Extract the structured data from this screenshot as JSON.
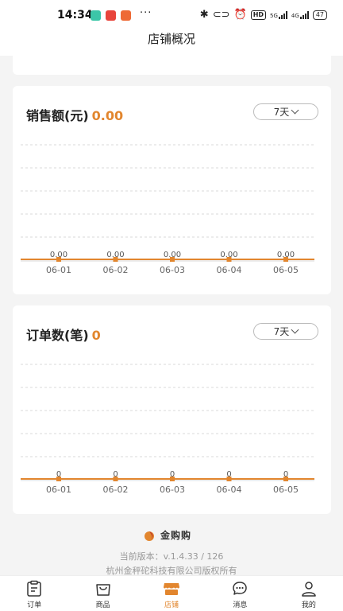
{
  "status_bar": {
    "time": "14:34",
    "dots": "···",
    "hd": "HD",
    "net1_label": "5G",
    "net2_label": "4G",
    "battery": "47"
  },
  "header": {
    "title": "店铺概况"
  },
  "sales_card": {
    "title": "销售额(元)",
    "total": "0.00",
    "period": "7天",
    "chart_data": {
      "type": "line",
      "categories": [
        "06-01",
        "06-02",
        "06-03",
        "06-04",
        "06-05"
      ],
      "series": [
        {
          "values": [
            0,
            0,
            0,
            0,
            0
          ],
          "labels": [
            "0.00",
            "0.00",
            "0.00",
            "0.00",
            "0.00"
          ]
        }
      ],
      "grid": true,
      "color": "#e2862e"
    }
  },
  "orders_card": {
    "title": "订单数(笔)",
    "total": "0",
    "period": "7天",
    "chart_data": {
      "type": "line",
      "categories": [
        "06-01",
        "06-02",
        "06-03",
        "06-04",
        "06-05"
      ],
      "series": [
        {
          "values": [
            0,
            0,
            0,
            0,
            0
          ],
          "labels": [
            "0",
            "0",
            "0",
            "0",
            "0"
          ]
        }
      ],
      "grid": true,
      "color": "#e2862e"
    }
  },
  "footer": {
    "logo_text": "金购购",
    "version": "当前版本：v.1.4.33 / 126",
    "copyright": "杭州金秤砣科技有限公司版权所有"
  },
  "tabs": [
    {
      "label": "订单",
      "icon": "order-icon",
      "active": false
    },
    {
      "label": "商品",
      "icon": "goods-icon",
      "active": false
    },
    {
      "label": "店铺",
      "icon": "store-icon",
      "active": true
    },
    {
      "label": "消息",
      "icon": "message-icon",
      "active": false
    },
    {
      "label": "我的",
      "icon": "profile-icon",
      "active": false
    }
  ],
  "colors": {
    "accent": "#e2862e",
    "grid": "#d8d8d8",
    "axis_text": "#666666"
  }
}
